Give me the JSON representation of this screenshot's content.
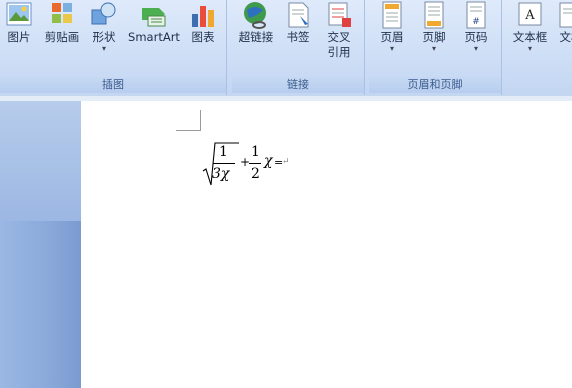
{
  "ribbon": {
    "groups": {
      "illustrations": {
        "label": "插图",
        "buttons": [
          {
            "label": "图片",
            "icon": "picture-icon"
          },
          {
            "label": "剪贴画",
            "icon": "clipart-icon"
          },
          {
            "label": "形状",
            "icon": "shapes-icon",
            "dropdown": "▾"
          },
          {
            "label": "SmartArt",
            "icon": "smartart-icon"
          },
          {
            "label": "图表",
            "icon": "chart-icon"
          }
        ]
      },
      "links": {
        "label": "链接",
        "buttons": [
          {
            "label": "超链接",
            "icon": "hyperlink-icon"
          },
          {
            "label": "书签",
            "icon": "bookmark-icon"
          },
          {
            "label": "交叉",
            "label2": "引用",
            "icon": "cross-reference-icon"
          }
        ]
      },
      "header_footer": {
        "label": "页眉和页脚",
        "buttons": [
          {
            "label": "页眉",
            "icon": "header-icon",
            "dropdown": "▾"
          },
          {
            "label": "页脚",
            "icon": "footer-icon",
            "dropdown": "▾"
          },
          {
            "label": "页码",
            "icon": "page-number-icon",
            "dropdown": "▾"
          }
        ]
      },
      "text": {
        "buttons": [
          {
            "label": "文本框",
            "icon": "textbox-icon",
            "dropdown": "▾"
          },
          {
            "label": "文档",
            "icon": "document-parts-icon"
          }
        ]
      }
    }
  },
  "document": {
    "formula": {
      "num1": "1",
      "den1": "3χ",
      "plus": "+",
      "num2": "1",
      "den2": "2",
      "var": "χ",
      "equals": "=",
      "paragraph_mark": "↵"
    }
  },
  "colors": {
    "ribbon_bg": "#dfeafb",
    "left_pane": "#8aa9da",
    "page": "#ffffff"
  }
}
